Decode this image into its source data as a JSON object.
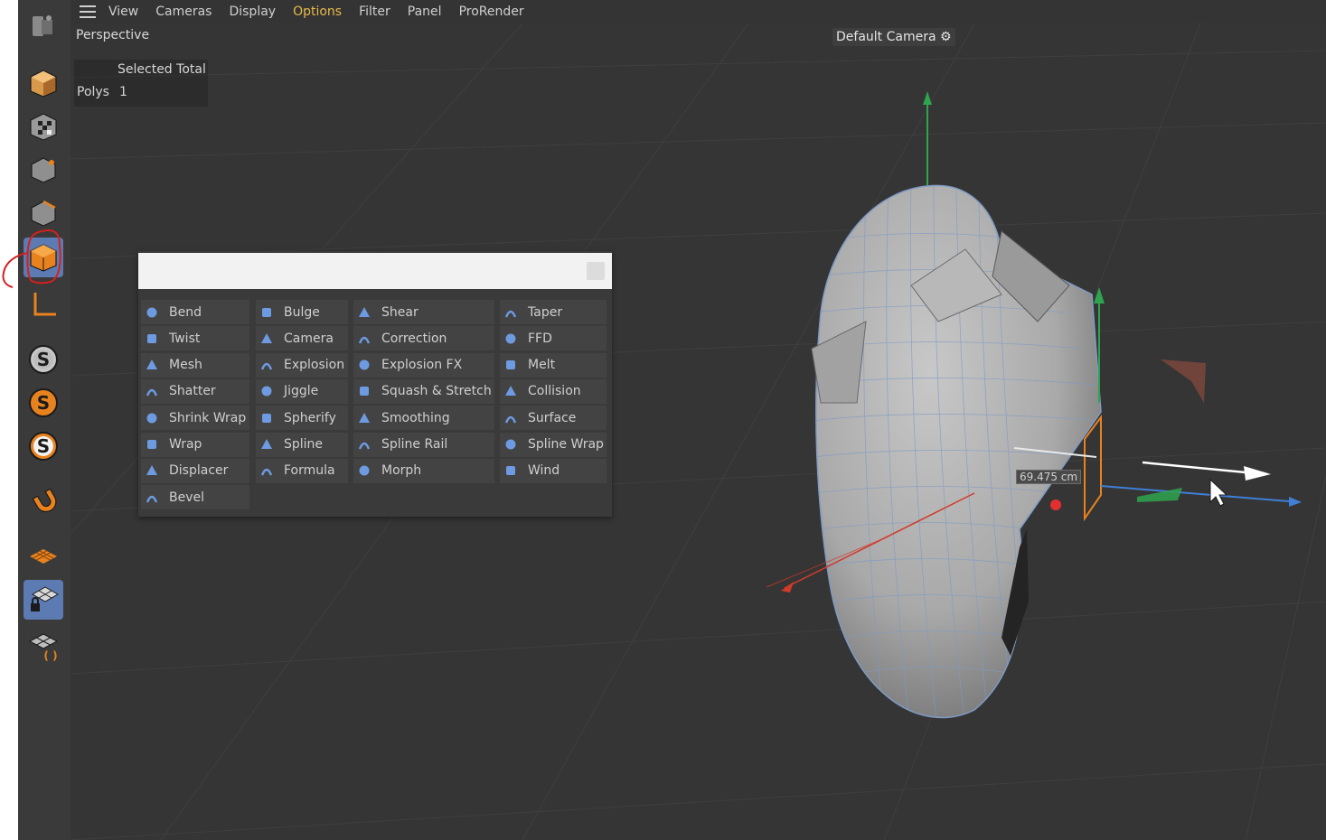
{
  "menu": {
    "items": [
      "View",
      "Cameras",
      "Display",
      "Options",
      "Filter",
      "Panel",
      "ProRender"
    ],
    "active": "Options"
  },
  "viewport": {
    "projection_label": "Perspective",
    "camera_label": "Default Camera",
    "hud": {
      "header": "Selected Total",
      "row_label": "Polys",
      "row_value": "1"
    },
    "measurement": "69.475 cm"
  },
  "toolbar": {
    "tools": [
      {
        "icon": "logo-icon"
      },
      {
        "icon": "points-mode-icon"
      },
      {
        "icon": "texture-mode-icon"
      },
      {
        "icon": "point-edit-icon"
      },
      {
        "icon": "edge-edit-icon"
      },
      {
        "icon": "polygon-edit-icon",
        "active": true
      },
      {
        "icon": "axis-mode-icon"
      },
      {
        "icon": "solo-off-icon"
      },
      {
        "icon": "solo-single-icon"
      },
      {
        "icon": "solo-hierarchy-icon"
      },
      {
        "icon": "snap-magnet-icon"
      },
      {
        "icon": "workplane-icon"
      },
      {
        "icon": "locked-workplane-icon",
        "active": true
      },
      {
        "icon": "planar-workplane-icon"
      }
    ]
  },
  "deformer_popup": {
    "search_value": "",
    "columns": [
      [
        {
          "label": "Bend",
          "icon": "bend-icon"
        },
        {
          "label": "Twist",
          "icon": "twist-icon"
        },
        {
          "label": "Mesh",
          "icon": "mesh-icon"
        },
        {
          "label": "Shatter",
          "icon": "shatter-icon"
        },
        {
          "label": "Shrink Wrap",
          "icon": "shrink-wrap-icon"
        },
        {
          "label": "Wrap",
          "icon": "wrap-icon"
        },
        {
          "label": "Displacer",
          "icon": "displacer-icon"
        },
        {
          "label": "Bevel",
          "icon": "bevel-icon"
        }
      ],
      [
        {
          "label": "Bulge",
          "icon": "bulge-icon"
        },
        {
          "label": "Camera",
          "icon": "camera-icon"
        },
        {
          "label": "Explosion",
          "icon": "explosion-icon"
        },
        {
          "label": "Jiggle",
          "icon": "jiggle-icon"
        },
        {
          "label": "Spherify",
          "icon": "spherify-icon"
        },
        {
          "label": "Spline",
          "icon": "spline-icon"
        },
        {
          "label": "Formula",
          "icon": "formula-icon"
        }
      ],
      [
        {
          "label": "Shear",
          "icon": "shear-icon"
        },
        {
          "label": "Correction",
          "icon": "correction-icon"
        },
        {
          "label": "Explosion FX",
          "icon": "explosion-fx-icon"
        },
        {
          "label": "Squash & Stretch",
          "icon": "squash-stretch-icon"
        },
        {
          "label": "Smoothing",
          "icon": "smoothing-icon"
        },
        {
          "label": "Spline Rail",
          "icon": "spline-rail-icon"
        },
        {
          "label": "Morph",
          "icon": "morph-icon"
        }
      ],
      [
        {
          "label": "Taper",
          "icon": "taper-icon"
        },
        {
          "label": "FFD",
          "icon": "ffd-icon"
        },
        {
          "label": "Melt",
          "icon": "melt-icon"
        },
        {
          "label": "Collision",
          "icon": "collision-icon"
        },
        {
          "label": "Surface",
          "icon": "surface-icon"
        },
        {
          "label": "Spline Wrap",
          "icon": "spline-wrap-icon"
        },
        {
          "label": "Wind",
          "icon": "wind-icon"
        }
      ]
    ]
  },
  "colors": {
    "accent_orange": "#e8821e",
    "selection_blue": "#5d7bb3",
    "active_menu": "#e8b94a",
    "annotation_red": "#d42020",
    "axis_x": "#d13a2a",
    "axis_y": "#2fa34e",
    "axis_z": "#3f7fd6"
  }
}
